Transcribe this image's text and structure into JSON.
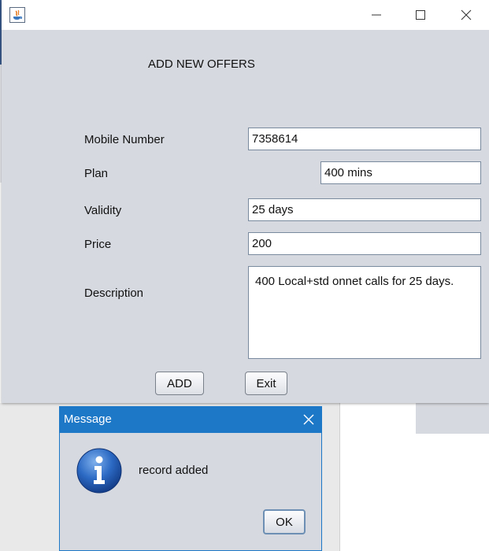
{
  "main_window": {
    "heading": "ADD NEW OFFERS",
    "fields": {
      "mobile_number": {
        "label": "Mobile Number",
        "value": "7358614"
      },
      "plan": {
        "label": "Plan",
        "value": "400 mins"
      },
      "validity": {
        "label": "Validity",
        "value": "25 days"
      },
      "price": {
        "label": "Price",
        "value": "200"
      },
      "description": {
        "label": "Description",
        "value": "400 Local+std onnet calls for 25 days."
      }
    },
    "buttons": {
      "add": "ADD",
      "exit": "Exit"
    }
  },
  "dialog": {
    "title": "Message",
    "message": "record added",
    "ok": "OK"
  },
  "colors": {
    "window_bg": "#d6d9e0",
    "dialog_titlebar": "#1e78c8",
    "info_icon": "#1e5ab4"
  },
  "icons": [
    "java-app-icon",
    "minimize-icon",
    "maximize-icon",
    "close-icon",
    "info-icon"
  ]
}
